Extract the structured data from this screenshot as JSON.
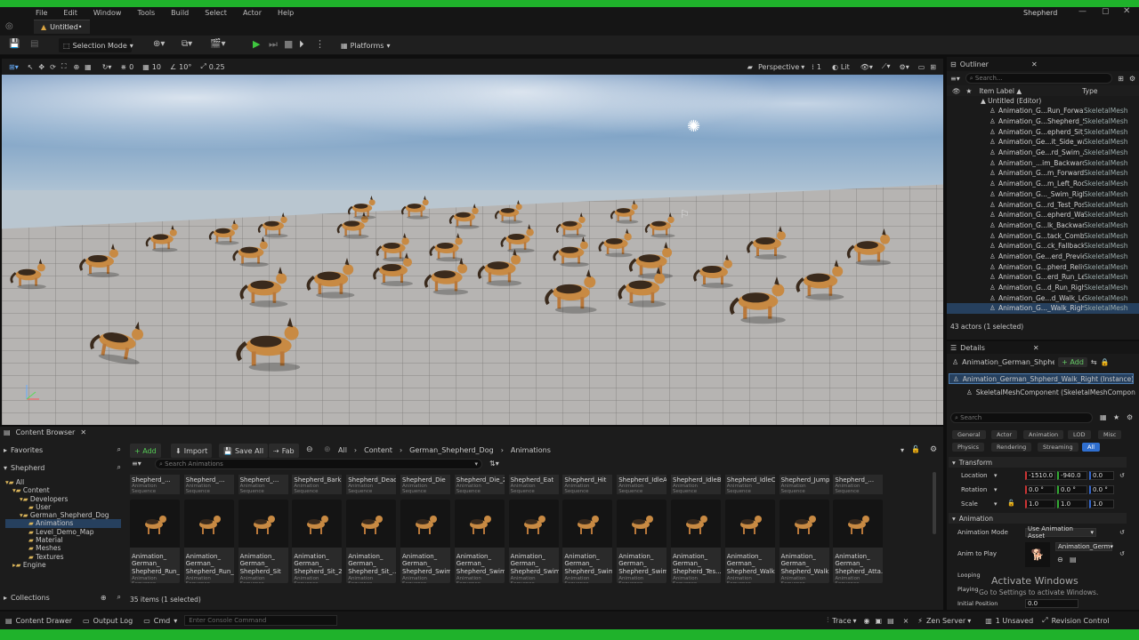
{
  "menu": [
    "File",
    "Edit",
    "Window",
    "Tools",
    "Build",
    "Select",
    "Actor",
    "Help"
  ],
  "window_title": "Shepherd",
  "tab_name": "Untitled•",
  "toolbar": {
    "selection_mode": "Selection Mode",
    "platforms": "Platforms"
  },
  "viewport_bar": {
    "angle_snap": "0",
    "move_snap": "10",
    "rot_snap": "10°",
    "scale_snap": "0.25",
    "perspective": "Perspective",
    "count": "1",
    "lit": "Lit"
  },
  "outliner": {
    "title": "Outliner",
    "search_placeholder": "Search...",
    "col_label": "Item Label ▲",
    "col_type": "Type",
    "root": "Untitled (Editor)",
    "items": [
      [
        "Animation_G...Run_Forward",
        "SkeletalMesh"
      ],
      [
        "Animation_G...Shepherd_Sit",
        "SkeletalMesh"
      ],
      [
        "Animation_G...epherd_Sit_2",
        "SkeletalMesh"
      ],
      [
        "Animation_Ge...it_Side_way",
        "SkeletalMesh"
      ],
      [
        "Animation_Ge...rd_Swim_All",
        "SkeletalMesh"
      ],
      [
        "Animation_...im_Backward",
        "SkeletalMesh"
      ],
      [
        "Animation_G...m_Forward_2",
        "SkeletalMesh"
      ],
      [
        "Animation_G...m_Left_Root",
        "SkeletalMesh"
      ],
      [
        "Animation_G..._Swim_Right",
        "SkeletalMesh"
      ],
      [
        "Animation_G...rd_Test_Pose",
        "SkeletalMesh"
      ],
      [
        "Animation_G...epherd_Walk",
        "SkeletalMesh"
      ],
      [
        "Animation_G...lk_Backward",
        "SkeletalMesh"
      ],
      [
        "Animation_G...tack_Combat",
        "SkeletalMesh"
      ],
      [
        "Animation_G...ck_Fallback",
        "SkeletalMesh"
      ],
      [
        "Animation_Ge...erd_Preview",
        "SkeletalMesh"
      ],
      [
        "Animation_G...pherd_Relive",
        "SkeletalMesh"
      ],
      [
        "Animation_G...erd_Run_Left",
        "SkeletalMesh"
      ],
      [
        "Animation_G...d_Run_Right",
        "SkeletalMesh"
      ],
      [
        "Animation_Ge...d_Walk_Left",
        "SkeletalMesh"
      ],
      [
        "Animation_G..._Walk_Right",
        "SkeletalMesh"
      ]
    ],
    "status": "43 actors (1 selected)"
  },
  "details": {
    "title": "Details",
    "actor_name": "Animation_German_Shpherd",
    "add": "+ Add",
    "instance": "Animation_German_Shpherd_Walk_Right (Instance)",
    "component": "SkeletalMeshComponent (SkeletalMeshComponen",
    "search_placeholder": "Search",
    "tabs_row1": [
      "General",
      "Actor",
      "Animation",
      "LOD",
      "Misc"
    ],
    "tabs_row2": [
      "Physics",
      "Rendering",
      "Streaming",
      "All"
    ],
    "transform": "Transform",
    "location_label": "Location",
    "rotation_label": "Rotation",
    "scale_label": "Scale",
    "location": [
      "-1510.0",
      "-940.0",
      "0.0"
    ],
    "rotation": [
      "0.0 °",
      "0.0 °",
      "0.0 °"
    ],
    "scale": [
      "1.0",
      "1.0",
      "1.0"
    ],
    "animation": "Animation",
    "anim_mode_label": "Animation Mode",
    "anim_mode": "Use Animation Asset",
    "anim_play_label": "Anim to Play",
    "anim_play": "Animation_Germ",
    "looping": "Looping",
    "playing": "Playing",
    "initial_position": "Initial Position",
    "initial_value": "0.0",
    "watermark1": "Activate Windows",
    "watermark2": "Go to Settings to activate Windows."
  },
  "content_browser": {
    "title": "Content Browser",
    "favorites": "Favorites",
    "shepherd": "Shepherd",
    "add": "+ Add",
    "import": "Import",
    "save_all": "Save All",
    "fab": "Fab",
    "path": [
      "All",
      "Content",
      "German_Shepherd_Dog",
      "Animations"
    ],
    "search_placeholder": "Search Animations",
    "tree": [
      "All",
      "Content",
      "Developers",
      "User",
      "German_Shepherd_Dog",
      "Animations",
      "Level_Demo_Map",
      "Material",
      "Meshes",
      "Textures",
      "Engine"
    ],
    "collections": "Collections",
    "top_row": [
      "Shepherd_...",
      "Shepherd_...",
      "Shepherd_...",
      "Shepherd_Bark",
      "Shepherd_Dead",
      "Shepherd_Die",
      "Shepherd_Die_2",
      "Shepherd_Eat",
      "Shepherd_Hit",
      "Shepherd_IdleA",
      "Shepherd_IdleB",
      "Shepherd_IdleC",
      "Shepherd_Jump",
      "Shepherd_..."
    ],
    "assets": [
      "Animation_\nGerman_\nShepherd_Run_",
      "Animation_\nGerman_\nShepherd_Run_",
      "Animation_\nGerman_\nShepherd_Sit",
      "Animation_\nGerman_\nShepherd_Sit_2",
      "Animation_\nGerman_\nShepherd_Sit_...",
      "Animation_\nGerman_\nShepherd_Swim",
      "Animation_\nGerman_\nShepherd_Swim",
      "Animation_\nGerman_\nShepherd_Swim",
      "Animation_\nGerman_\nShepherd_Swim",
      "Animation_\nGerman_\nShepherd_Swim",
      "Animation_\nGerman_\nShepherd_Tes...",
      "Animation_\nGerman_\nShepherd_Walk",
      "Animation_\nGerman_\nShepherd_Walk",
      "Animation_\nGerman_\nShepherd_Atta..."
    ],
    "asset_type": "Animation Sequence",
    "count": "35 items (1 selected)"
  },
  "status": {
    "drawer": "Content Drawer",
    "output": "Output Log",
    "cmd": "Cmd",
    "console_placeholder": "Enter Console Command",
    "trace": "Trace",
    "zen": "Zen Server",
    "unsaved": "1 Unsaved",
    "revision": "Revision Control"
  }
}
